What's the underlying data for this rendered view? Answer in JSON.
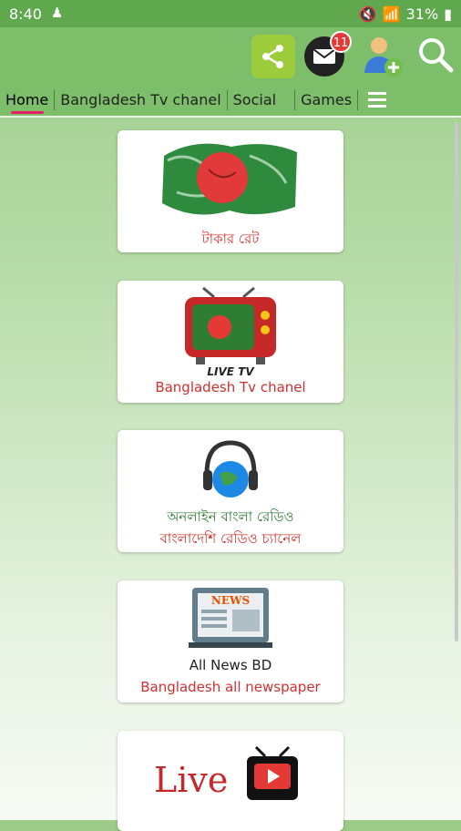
{
  "status": {
    "time": "8:40",
    "battery": "31%"
  },
  "toolbar": {
    "notification_count": "11"
  },
  "tabs": [
    {
      "label": "Home",
      "active": true
    },
    {
      "label": "Bangladesh Tv chanel"
    },
    {
      "label": "Social"
    },
    {
      "label": "Games"
    }
  ],
  "cards": [
    {
      "label": "টাকার রেট",
      "icon": "bangladesh-flag-icon"
    },
    {
      "label": "Bangladesh Tv chanel",
      "icon": "live-tv-icon",
      "icon_text": "LIVE TV"
    },
    {
      "label_line1": "অনলাইন বাংলা রেডিও",
      "label_line2": "বাংলাদেশি রেডিও  চ্যানেল",
      "icon": "radio-headphones-icon"
    },
    {
      "label": "Bangladesh all newspaper",
      "icon": "news-monitor-icon",
      "icon_text": "NEWS",
      "brand": "All News BD"
    },
    {
      "label": "Live",
      "icon": "live-youtube-tv-icon"
    }
  ],
  "colors": {
    "statusbar": "#5fa84e",
    "appbar": "#7dbe6a",
    "accent": "#e91e63",
    "label": "#d32f2f"
  }
}
